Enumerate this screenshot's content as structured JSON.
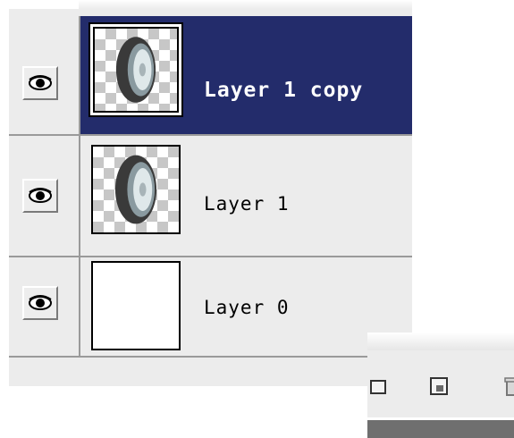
{
  "layers_panel": {
    "layers": [
      {
        "name": "Layer 1 copy",
        "selected": true,
        "visible": true,
        "thumbnail": "wheel-on-transparent"
      },
      {
        "name": "Layer 1",
        "selected": false,
        "visible": true,
        "thumbnail": "wheel-on-transparent"
      },
      {
        "name": "Layer 0",
        "selected": false,
        "visible": true,
        "thumbnail": "white-fill"
      }
    ]
  },
  "toolbar": {
    "buttons": [
      {
        "icon": "new-group-icon"
      },
      {
        "icon": "new-layer-icon"
      },
      {
        "icon": "trash-icon"
      }
    ]
  },
  "colors": {
    "selected_row": "#232c6b",
    "panel_bg": "#ececec",
    "divider": "#9a9a9a"
  }
}
